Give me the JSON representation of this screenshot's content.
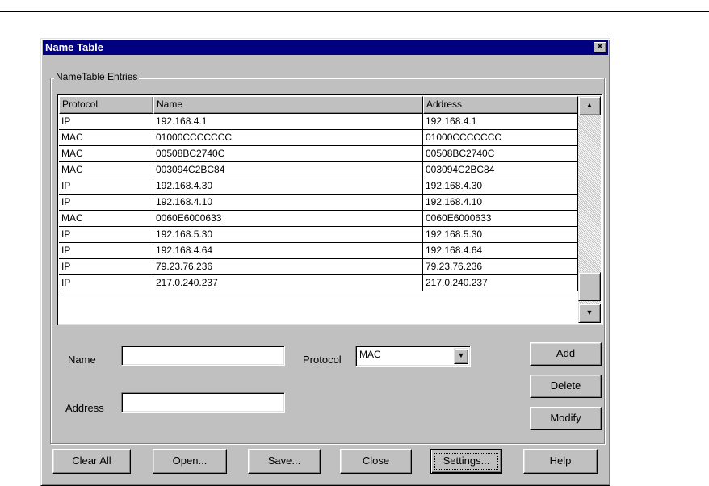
{
  "window": {
    "title": "Name Table",
    "close_glyph": "✕"
  },
  "groupbox": {
    "label": "NameTable Entries"
  },
  "table": {
    "columns": [
      "Protocol",
      "Name",
      "Address"
    ],
    "rows": [
      [
        "IP",
        "192.168.4.1",
        "192.168.4.1"
      ],
      [
        "MAC",
        "01000CCCCCCC",
        "01000CCCCCCC"
      ],
      [
        "MAC",
        "00508BC2740C",
        "00508BC2740C"
      ],
      [
        "MAC",
        "003094C2BC84",
        "003094C2BC84"
      ],
      [
        "IP",
        "192.168.4.30",
        "192.168.4.30"
      ],
      [
        "IP",
        "192.168.4.10",
        "192.168.4.10"
      ],
      [
        "MAC",
        "0060E6000633",
        "0060E6000633"
      ],
      [
        "IP",
        "192.168.5.30",
        "192.168.5.30"
      ],
      [
        "IP",
        "192.168.4.64",
        "192.168.4.64"
      ],
      [
        "IP",
        "79.23.76.236",
        "79.23.76.236"
      ],
      [
        "IP",
        "217.0.240.237",
        "217.0.240.237"
      ]
    ],
    "scroll_position": 0.92
  },
  "form": {
    "name_label": "Name",
    "name_value": "",
    "address_label": "Address",
    "address_value": "",
    "protocol_label": "Protocol",
    "protocol_value": "MAC"
  },
  "side_buttons": {
    "add": "Add",
    "delete": "Delete",
    "modify": "Modify"
  },
  "bottom_buttons": {
    "clear_all": "Clear All",
    "open": "Open...",
    "save": "Save...",
    "close": "Close",
    "settings": "Settings...",
    "help": "Help"
  },
  "colors": {
    "title_bar": "#000080",
    "dialog_face": "#c0c0c0"
  },
  "icons": {
    "up_arrow": "▲",
    "down_arrow": "▼",
    "combo_arrow": "▼"
  }
}
